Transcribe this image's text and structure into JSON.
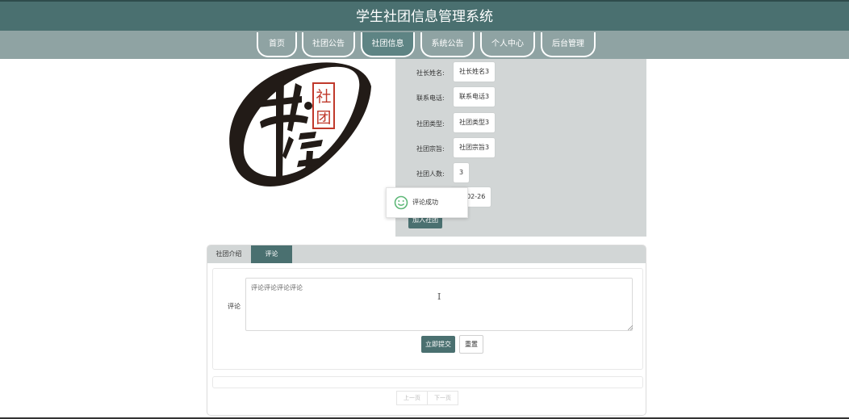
{
  "header": {
    "title": "学生社团信息管理系统"
  },
  "nav": {
    "items": [
      {
        "label": "首页"
      },
      {
        "label": "社团公告"
      },
      {
        "label": "社团信息"
      },
      {
        "label": "系统公告"
      },
      {
        "label": "个人中心"
      },
      {
        "label": "后台管理"
      }
    ],
    "active": "社团信息"
  },
  "logo": {
    "glyph_main": "书法",
    "seal_text": "社团"
  },
  "info": {
    "fields": [
      {
        "label": "社长姓名:",
        "value": "社长姓名3"
      },
      {
        "label": "联系电话:",
        "value": "联系电话3"
      },
      {
        "label": "社团类型:",
        "value": "社团类型3"
      },
      {
        "label": "社团宗旨:",
        "value": "社团宗旨3"
      },
      {
        "label": "社团人数:",
        "value": "3"
      },
      {
        "label": "",
        "value": "22-02-26"
      }
    ],
    "join_label": "加入社团"
  },
  "toast": {
    "message": "评论成功"
  },
  "tabs": [
    {
      "label": "社团介绍"
    },
    {
      "label": "评论"
    }
  ],
  "comment_form": {
    "label": "评论",
    "value": "评论评论评论评论",
    "submit_label": "立即提交",
    "reset_label": "重置"
  },
  "pager": {
    "prev_label": "上一页",
    "next_label": "下一页"
  },
  "colors": {
    "primary": "#4a7070",
    "nav_bg": "#8fa3a3",
    "panel_bg": "#d2d6d6"
  }
}
